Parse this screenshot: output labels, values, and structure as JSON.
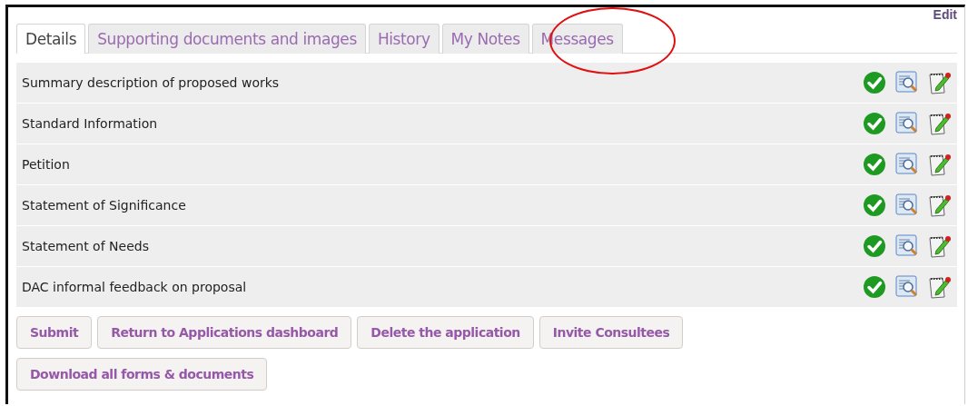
{
  "edit_link": "Edit",
  "tabs": [
    {
      "label": "Details",
      "selected": true
    },
    {
      "label": "Supporting documents and images",
      "selected": false
    },
    {
      "label": "History",
      "selected": false
    },
    {
      "label": "My Notes",
      "selected": false
    },
    {
      "label": "Messages",
      "selected": false
    }
  ],
  "sections": [
    {
      "title": "Summary description of proposed works"
    },
    {
      "title": "Standard Information"
    },
    {
      "title": "Petition"
    },
    {
      "title": "Statement of Significance"
    },
    {
      "title": "Statement of Needs"
    },
    {
      "title": "DAC informal feedback on proposal"
    }
  ],
  "button_rows": [
    [
      "Submit",
      "Return to Applications dashboard",
      "Delete the application",
      "Invite Consultees"
    ],
    [
      "Download all forms & documents"
    ]
  ]
}
